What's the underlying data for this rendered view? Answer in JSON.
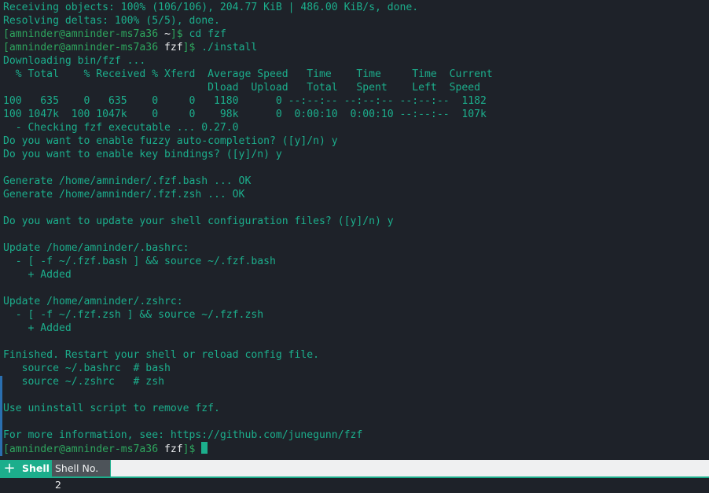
{
  "terminal": {
    "lines": [
      {
        "type": "text",
        "text": "Receiving objects: 100% (106/106), 204.77 KiB | 486.00 KiB/s, done."
      },
      {
        "type": "text",
        "text": "Resolving deltas: 100% (5/5), done."
      },
      {
        "type": "prompt",
        "user_host": "[amninder@amninder-ms7a36 ",
        "dir": "~",
        "end": "]$",
        "command": " cd fzf"
      },
      {
        "type": "prompt",
        "user_host": "[amninder@amninder-ms7a36 ",
        "dir": "fzf",
        "end": "]$",
        "command": " ./install"
      },
      {
        "type": "text",
        "text": "Downloading bin/fzf ..."
      },
      {
        "type": "text",
        "text": "  % Total    % Received % Xferd  Average Speed   Time    Time     Time  Current"
      },
      {
        "type": "text",
        "text": "                                 Dload  Upload   Total   Spent    Left  Speed"
      },
      {
        "type": "text",
        "text": "100   635    0   635    0     0   1180      0 --:--:-- --:--:-- --:--:--  1182"
      },
      {
        "type": "text",
        "text": "100 1047k  100 1047k    0     0    98k      0  0:00:10  0:00:10 --:--:--  107k"
      },
      {
        "type": "text",
        "text": "  - Checking fzf executable ... 0.27.0"
      },
      {
        "type": "text",
        "text": "Do you want to enable fuzzy auto-completion? ([y]/n) y"
      },
      {
        "type": "text",
        "text": "Do you want to enable key bindings? ([y]/n) y"
      },
      {
        "type": "text",
        "text": ""
      },
      {
        "type": "text",
        "text": "Generate /home/amninder/.fzf.bash ... OK"
      },
      {
        "type": "text",
        "text": "Generate /home/amninder/.fzf.zsh ... OK"
      },
      {
        "type": "text",
        "text": ""
      },
      {
        "type": "text",
        "text": "Do you want to update your shell configuration files? ([y]/n) y"
      },
      {
        "type": "text",
        "text": ""
      },
      {
        "type": "text",
        "text": "Update /home/amninder/.bashrc:"
      },
      {
        "type": "text",
        "text": "  - [ -f ~/.fzf.bash ] && source ~/.fzf.bash"
      },
      {
        "type": "text",
        "text": "    + Added"
      },
      {
        "type": "text",
        "text": ""
      },
      {
        "type": "text",
        "text": "Update /home/amninder/.zshrc:"
      },
      {
        "type": "text",
        "text": "  - [ -f ~/.fzf.zsh ] && source ~/.fzf.zsh"
      },
      {
        "type": "text",
        "text": "    + Added"
      },
      {
        "type": "text",
        "text": ""
      },
      {
        "type": "text",
        "text": "Finished. Restart your shell or reload config file."
      },
      {
        "type": "text",
        "text": "   source ~/.bashrc  # bash"
      },
      {
        "type": "text",
        "text": "   source ~/.zshrc   # zsh"
      },
      {
        "type": "text",
        "text": ""
      },
      {
        "type": "text",
        "text": "Use uninstall script to remove fzf."
      },
      {
        "type": "text",
        "text": ""
      },
      {
        "type": "text",
        "text": "For more information, see: https://github.com/junegunn/fzf"
      },
      {
        "type": "prompt",
        "user_host": "[amninder@amninder-ms7a36 ",
        "dir": "fzf",
        "end": "]$",
        "command": " ",
        "cursor": true
      }
    ]
  },
  "tabbar": {
    "new_tab_icon": "+",
    "tabs": [
      {
        "label": "Shell",
        "active": true
      },
      {
        "label": "Shell No. 2",
        "active": false
      }
    ]
  },
  "colors": {
    "background": "#1e2229",
    "text": "#1cae8c",
    "prompt": "#2ea65e",
    "accent": "#1cae8c"
  }
}
